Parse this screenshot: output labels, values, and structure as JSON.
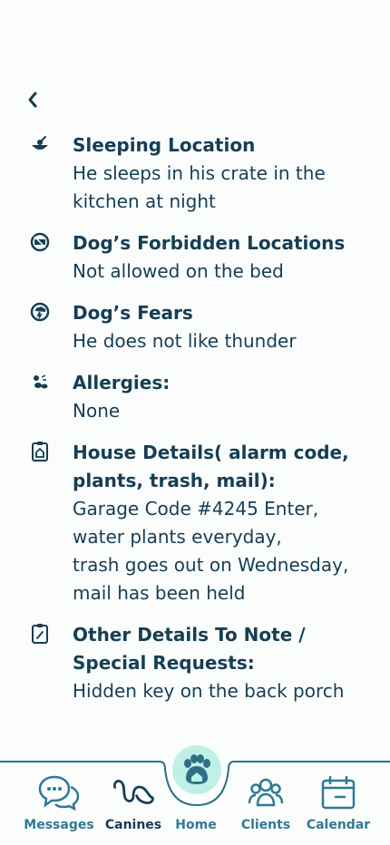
{
  "sections": [
    {
      "icon": "dog-bed-icon",
      "title": "Sleeping Location",
      "body": [
        "He sleeps in his crate in the",
        "kitchen at night"
      ]
    },
    {
      "icon": "no-entry-icon",
      "title": "Dog’s Forbidden Locations",
      "body": [
        "Not allowed on the bed"
      ]
    },
    {
      "icon": "storm-icon",
      "title": "Dog’s Fears",
      "body": [
        "He does not like thunder"
      ]
    },
    {
      "icon": "allergy-icon",
      "title": "Allergies:",
      "body": [
        "None"
      ]
    },
    {
      "icon": "house-clipboard-icon",
      "title": "House Details( alarm code,",
      "title2": "plants, trash, mail):",
      "body": [
        "Garage Code #4245 Enter,",
        "water plants everyday,",
        "trash goes out on Wednesday,",
        "mail has been held"
      ]
    },
    {
      "icon": "clipboard-note-icon",
      "title": "Other Details To Note /",
      "title2": "Special Requests:",
      "body": [
        "Hidden key on the back porch"
      ]
    }
  ],
  "nav": {
    "items": [
      {
        "label": "Messages",
        "icon": "chat-bubbles-icon"
      },
      {
        "label": "Canines",
        "icon": "canine-paws-icon",
        "active": true
      },
      {
        "label": "Home",
        "icon": "paw-home-icon"
      },
      {
        "label": "Clients",
        "icon": "people-icon"
      },
      {
        "label": "Calendar",
        "icon": "calendar-icon"
      }
    ]
  },
  "colors": {
    "text": "#163e54",
    "nav_label": "#2f7a93",
    "home_bubble": "#bff0e6"
  }
}
